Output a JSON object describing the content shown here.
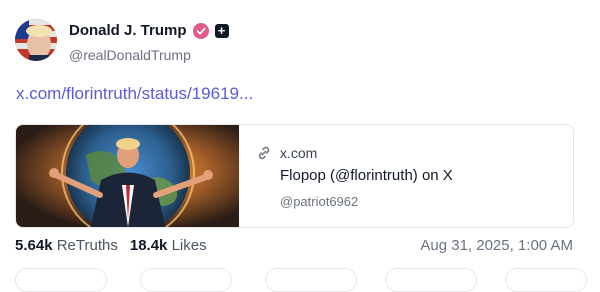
{
  "author": {
    "display_name": "Donald J. Trump",
    "handle": "@realDonaldTrump",
    "verified_color": "#e05a8a"
  },
  "post": {
    "link_text": "x.com/florintruth/status/19619..."
  },
  "link_card": {
    "domain": "x.com",
    "title": "Flopop (@florintruth) on X",
    "author": "@patriot6962"
  },
  "stats": {
    "retruths_count": "5.64k",
    "retruths_label": "ReTruths",
    "likes_count": "18.4k",
    "likes_label": "Likes"
  },
  "timestamp": "Aug 31, 2025, 1:00 AM",
  "colors": {
    "link": "#5b5bd6",
    "accent_badge": "#e05a8a"
  }
}
